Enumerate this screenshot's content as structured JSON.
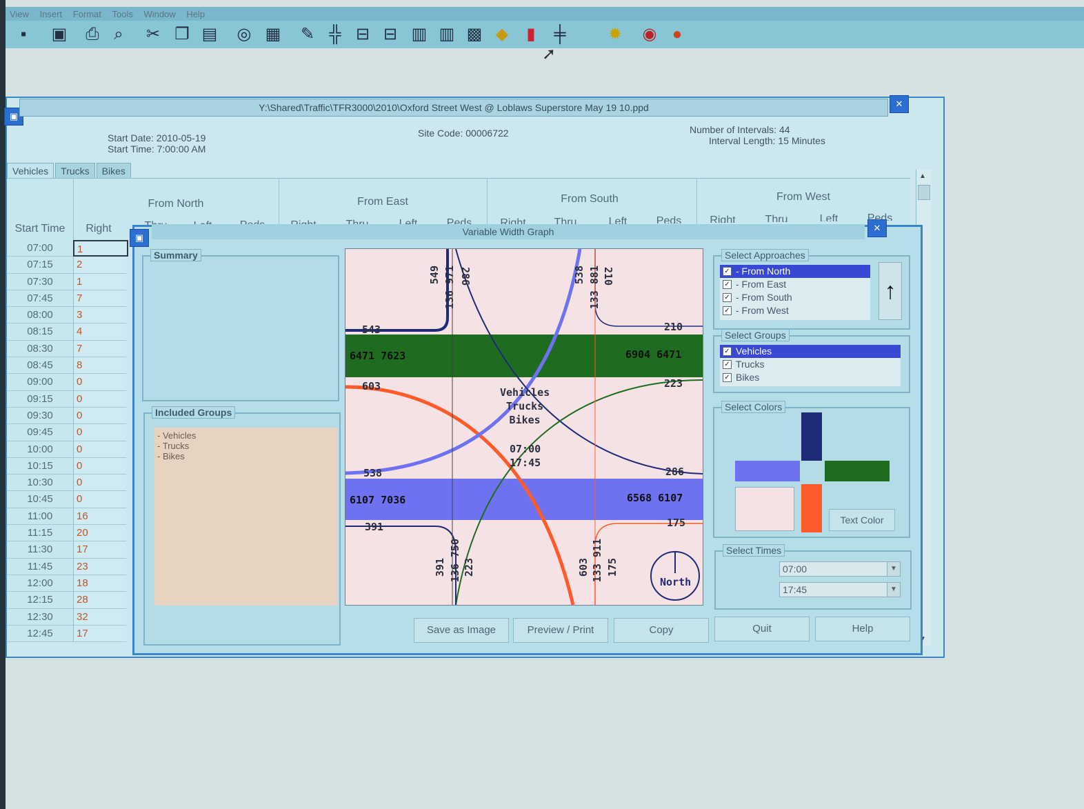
{
  "menu": [
    "View",
    "Insert",
    "Format",
    "Tools",
    "Window",
    "Help"
  ],
  "toolbar_icons": [
    "save-icon",
    "monitor-icon",
    "print-icon",
    "print-preview-icon",
    "cut-icon",
    "copy-icon",
    "paste-icon",
    "find-icon",
    "calculator-icon",
    "edit-icon",
    "intersection-icon",
    "align-left-icon",
    "align-right-icon",
    "bar-chart-icon",
    "bar-chart-2-icon",
    "map-icon",
    "road-sign-icon",
    "histogram-icon",
    "lane-icon",
    "gear-icon",
    "globe-icon",
    "color-icon"
  ],
  "document": {
    "title": "Y:\\Shared\\Traffic\\TFR3000\\2010\\Oxford Street West @ Loblaws Superstore May 19 10.ppd",
    "start_date": "Start Date: 2010-05-19",
    "start_time": "Start Time: 7:00:00 AM",
    "site_code": "Site Code: 00006722",
    "intervals": "Number of Intervals: 44",
    "interval_length": "Interval Length: 15 Minutes",
    "tabs": [
      "Vehicles",
      "Trucks",
      "Bikes"
    ]
  },
  "grid": {
    "approaches": [
      "From North",
      "From East",
      "From South",
      "From West"
    ],
    "start_time_header": "Start Time",
    "right_header": "Right",
    "sub_headers": [
      "Thru",
      "Left",
      "Peds",
      "Right",
      "Thru",
      "Left",
      "Peds",
      "Right",
      "Thru",
      "Left",
      "Peds",
      "Right",
      "Thru",
      "Left",
      "Peds"
    ],
    "rows": [
      {
        "time": "07:00",
        "value": "1"
      },
      {
        "time": "07:15",
        "value": "2"
      },
      {
        "time": "07:30",
        "value": "1"
      },
      {
        "time": "07:45",
        "value": "7"
      },
      {
        "time": "08:00",
        "value": "3"
      },
      {
        "time": "08:15",
        "value": "4"
      },
      {
        "time": "08:30",
        "value": "7"
      },
      {
        "time": "08:45",
        "value": "8"
      },
      {
        "time": "09:00",
        "value": "0"
      },
      {
        "time": "09:15",
        "value": "0"
      },
      {
        "time": "09:30",
        "value": "0"
      },
      {
        "time": "09:45",
        "value": "0"
      },
      {
        "time": "10:00",
        "value": "0"
      },
      {
        "time": "10:15",
        "value": "0"
      },
      {
        "time": "10:30",
        "value": "0"
      },
      {
        "time": "10:45",
        "value": "0"
      },
      {
        "time": "11:00",
        "value": "16"
      },
      {
        "time": "11:15",
        "value": "20"
      },
      {
        "time": "11:30",
        "value": "17"
      },
      {
        "time": "11:45",
        "value": "23"
      },
      {
        "time": "12:00",
        "value": "18"
      },
      {
        "time": "12:15",
        "value": "28"
      },
      {
        "time": "12:30",
        "value": "32"
      },
      {
        "time": "12:45",
        "value": "17"
      }
    ]
  },
  "dialog": {
    "title": "Variable Width Graph",
    "summary_caption": "Summary",
    "included_caption": "Included Groups",
    "included_items": [
      "- Vehicles",
      "- Trucks",
      "- Bikes"
    ],
    "approaches_caption": "Select Approaches",
    "approaches": [
      "- From North",
      "- From East",
      "- From South",
      "- From West"
    ],
    "groups_caption": "Select Groups",
    "groups": [
      "Vehicles",
      "Trucks",
      "Bikes"
    ],
    "colors_caption": "Select Colors",
    "text_color_label": "Text Color",
    "times_caption": "Select Times",
    "time_start": "07:00",
    "time_end": "17:45",
    "buttons": [
      "Save as Image",
      "Preview / Print",
      "Copy",
      "Quit",
      "Help"
    ],
    "colors": {
      "north": "#1f2b78",
      "east": "#1f6b1f",
      "south": "#ff5a2a",
      "west": "#6e72f0",
      "background": "#f4e2e4"
    }
  },
  "graph": {
    "north": {
      "top_labels": [
        "549",
        "136 971",
        "286"
      ],
      "left_row": "543"
    },
    "north2": {
      "top_labels": [
        "538",
        "133 881",
        "210"
      ],
      "right_row": "210"
    },
    "east_band": {
      "left": "6471  7623",
      "right": "6904  6471"
    },
    "row_603_left": "603",
    "row_223_right": "223",
    "center_lines": [
      "Vehicles",
      "Trucks",
      "Bikes"
    ],
    "center_times": [
      "07:00",
      "17:45"
    ],
    "row_538_left": "538",
    "row_286_right": "286",
    "west_band": {
      "left": "6107  7036",
      "right": "6568  6107"
    },
    "row_391_left": "391",
    "row_175_right": "175",
    "south_labels_left": [
      "391",
      "136 750",
      "223"
    ],
    "south_labels_right": [
      "603",
      "133 911",
      "175"
    ],
    "north_label": "North"
  }
}
